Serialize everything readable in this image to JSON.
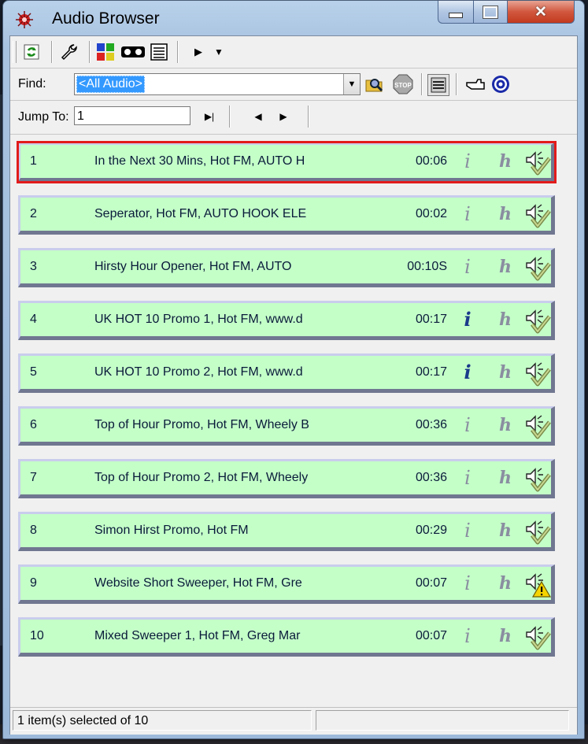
{
  "window": {
    "title": "Audio Browser"
  },
  "find": {
    "label": "Find:",
    "value": "<All Audio>"
  },
  "jump": {
    "label": "Jump To:",
    "value": "1"
  },
  "rows": [
    {
      "num": "1",
      "title": "In the Next 30 Mins, Hot FM, AUTO H",
      "dur": "00:06",
      "info": "i",
      "hook": "h",
      "info_active": false,
      "status": "ok"
    },
    {
      "num": "2",
      "title": "Seperator, Hot FM, AUTO HOOK ELE",
      "dur": "00:02",
      "info": "i",
      "hook": "h",
      "info_active": false,
      "status": "ok"
    },
    {
      "num": "3",
      "title": "Hirsty Hour Opener, Hot FM, AUTO",
      "dur": "00:10S",
      "info": "i",
      "hook": "h",
      "info_active": false,
      "status": "ok"
    },
    {
      "num": "4",
      "title": "UK HOT 10 Promo 1, Hot FM, www.d",
      "dur": "00:17",
      "info": "i",
      "hook": "h",
      "info_active": true,
      "status": "ok"
    },
    {
      "num": "5",
      "title": "UK HOT 10 Promo 2, Hot FM, www.d",
      "dur": "00:17",
      "info": "i",
      "hook": "h",
      "info_active": true,
      "status": "ok"
    },
    {
      "num": "6",
      "title": "Top of Hour Promo, Hot FM, Wheely B",
      "dur": "00:36",
      "info": "i",
      "hook": "h",
      "info_active": false,
      "status": "ok"
    },
    {
      "num": "7",
      "title": "Top of Hour Promo 2, Hot FM, Wheely",
      "dur": "00:36",
      "info": "i",
      "hook": "h",
      "info_active": false,
      "status": "ok"
    },
    {
      "num": "8",
      "title": "Simon Hirst Promo, Hot FM",
      "dur": "00:29",
      "info": "i",
      "hook": "h",
      "info_active": false,
      "status": "ok"
    },
    {
      "num": "9",
      "title": "Website Short Sweeper, Hot FM, Gre",
      "dur": "00:07",
      "info": "i",
      "hook": "h",
      "info_active": false,
      "status": "warning"
    },
    {
      "num": "10",
      "title": "Mixed Sweeper 1, Hot FM, Greg Mar",
      "dur": "00:07",
      "info": "i",
      "hook": "h",
      "info_active": false,
      "status": "ok"
    }
  ],
  "selected_row": "1",
  "statusbar": {
    "text": "1 item(s) selected of 10"
  },
  "colors": {
    "row_bg": "#c4ffc8",
    "selection": "#e21b1b",
    "close_button": "#c23a1e"
  },
  "icons": [
    "refresh-icon",
    "wrench-icon",
    "color-grid-icon",
    "cart-view-icon",
    "list-view-icon",
    "play-icon",
    "dropdown-arrow-icon",
    "search-folder-icon",
    "stop-icon",
    "cart-machine-icon",
    "hand-point-icon",
    "target-icon",
    "jump-end-icon",
    "prev-icon",
    "next-icon",
    "speaker-check-icon",
    "speaker-warning-icon"
  ]
}
